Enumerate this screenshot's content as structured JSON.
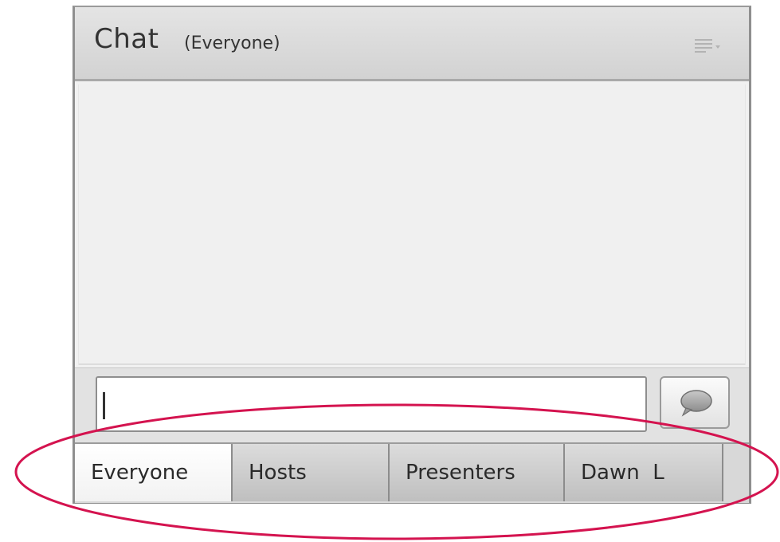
{
  "pod": {
    "title": "Chat",
    "subtitle": "(Everyone)",
    "menu_icon": "pod-options-menu-icon"
  },
  "composer": {
    "value": "",
    "placeholder": "",
    "send_icon": "speech-bubble-icon"
  },
  "tabs": [
    {
      "label": "Everyone",
      "active": true
    },
    {
      "label": "Hosts",
      "active": false
    },
    {
      "label": "Presenters",
      "active": false
    },
    {
      "label": "Dawn  L",
      "active": false
    }
  ],
  "annotation": {
    "shape": "ellipse",
    "color": "#d4134f"
  }
}
